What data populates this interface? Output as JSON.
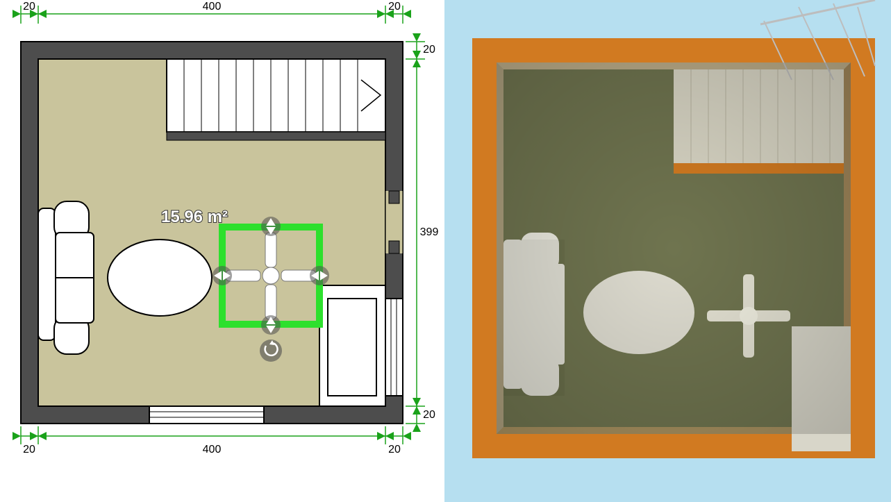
{
  "plan2d": {
    "dims": {
      "top_left_wall": "20",
      "top_width": "400",
      "top_right_wall": "20",
      "right_top_wall": "20",
      "right_height": "399",
      "right_bottom_wall": "20",
      "bottom_left_wall": "20",
      "bottom_width": "400",
      "bottom_right_wall": "20"
    },
    "room_area": "15.96 m²"
  },
  "selected_object": {
    "name": "ceiling-fan",
    "selection_color": "#2DE02D"
  },
  "colors": {
    "floor_2d": "#c9c49c",
    "wall_2d": "#4d4d4d",
    "dim_green": "#1aa21a",
    "wall_3d": "#d17a21",
    "floor_3d_shaded": "#8e9163",
    "sky_3d": "#b6dff0"
  }
}
